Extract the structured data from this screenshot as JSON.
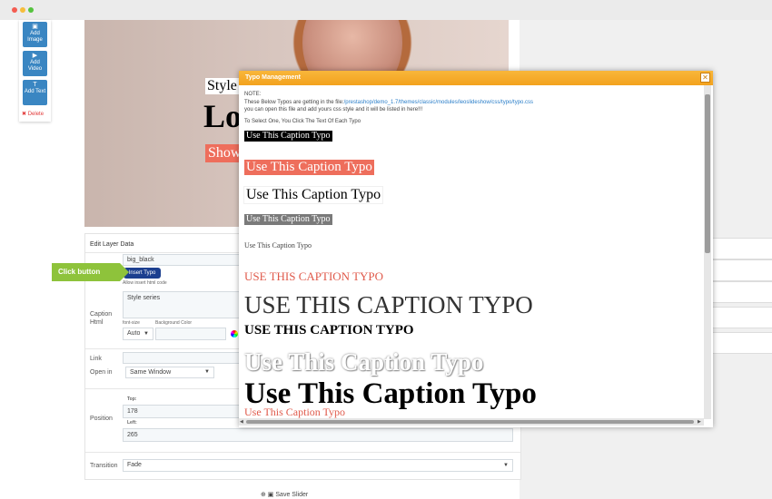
{
  "toolbar": {
    "add_image": "Add Image",
    "add_video": "Add Video",
    "add_text": "Add Text",
    "delete": "Delete"
  },
  "preview": {
    "layer_style": "Style",
    "layer_big": "Lo",
    "layer_show": "Show"
  },
  "edit_layer": {
    "title": "Edit Layer Data",
    "class_value": "big_black",
    "insert_button": "Insert Typo",
    "allow_html": "Allow insert html code",
    "caption_label": "Caption Html",
    "caption_value": "Style series",
    "font_size_label": "font-size",
    "font_size_value": "Auto",
    "bg_color_label": "Background Color",
    "link_label": "Link",
    "open_in_label": "Open in",
    "open_in_value": "Same Window",
    "position_label": "Position",
    "top_label": "Top:",
    "top_value": "178",
    "left_label": "Left:",
    "left_value": "265",
    "transition_label": "Transition",
    "transition_value": "Fade"
  },
  "callout": {
    "text": "Click button"
  },
  "save_button": "Save Slider",
  "modal": {
    "title": "Typo Management",
    "close_icon": "close-icon",
    "note_heading": "NOTE:",
    "note_line1_prefix": "These Below Typos are getting in the file:",
    "note_line1_path": "/prestashop/demo_1.7/themes/classic/modules/leoslideshow/css/typo/typo.css",
    "note_line2": "you can open this file and add yours css style and it will be listed in here!!!",
    "instruction": "To Select One, You Click The Text Of Each Typo",
    "typos": [
      "Use This Caption Typo",
      "Use This Caption Typo",
      "Use This Caption Typo",
      "Use This Caption Typo",
      "Use This Caption Typo",
      "Use This Caption Typo",
      "Use This Caption Typo",
      "Use This Caption Typo",
      "Use This Caption Typo",
      "Use This Caption Typo",
      "Use This Caption Typo"
    ]
  }
}
